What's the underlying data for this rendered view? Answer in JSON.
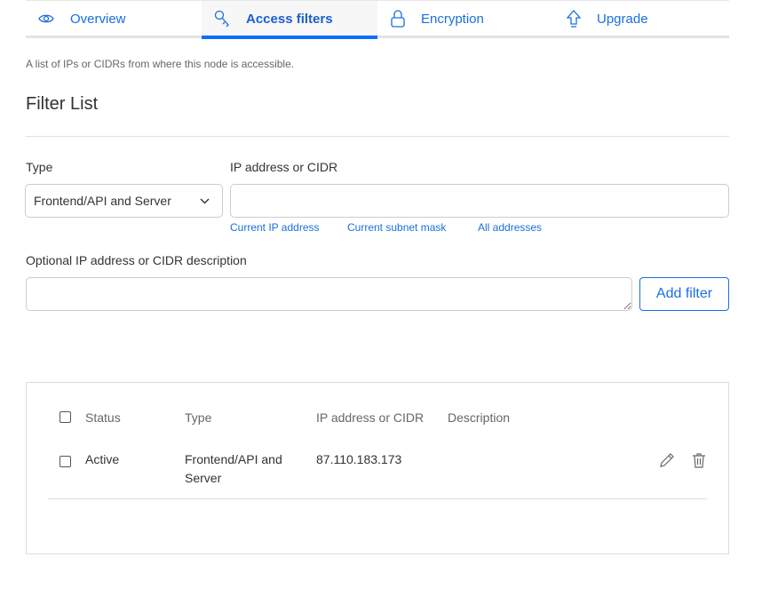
{
  "tabs": [
    {
      "label": "Overview",
      "icon": "eye-icon"
    },
    {
      "label": "Access filters",
      "icon": "key-icon"
    },
    {
      "label": "Encryption",
      "icon": "lock-icon"
    },
    {
      "label": "Upgrade",
      "icon": "arrow-up-icon"
    }
  ],
  "description": "A list of IPs or CIDRs from where this node is accessible.",
  "section_title": "Filter List",
  "form": {
    "type_label": "Type",
    "type_value": "Frontend/API and Server",
    "ip_label": "IP address or CIDR",
    "ip_value": "",
    "links": [
      "Current IP address",
      "Current subnet mask",
      "All addresses"
    ],
    "desc_label": "Optional IP address or CIDR description",
    "desc_value": "",
    "add_button": "Add filter"
  },
  "table": {
    "headers": [
      "Status",
      "Type",
      "IP address or CIDR",
      "Description"
    ],
    "rows": [
      {
        "status": "Active",
        "type": "Frontend/API and Server",
        "ip": "87.110.183.173",
        "description": ""
      }
    ]
  },
  "colors": {
    "accent": "#0d6efd"
  }
}
